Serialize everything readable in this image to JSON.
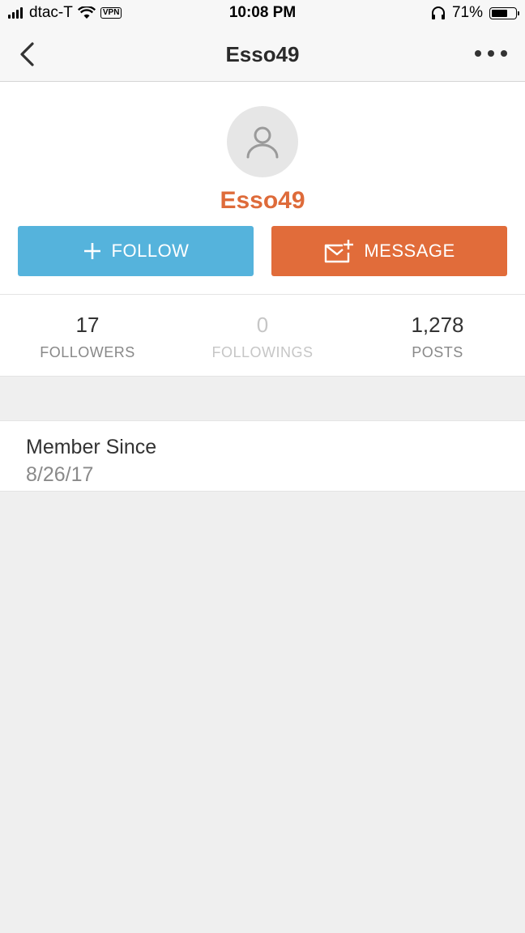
{
  "status_bar": {
    "carrier": "dtac-T",
    "vpn_label": "VPN",
    "time": "10:08 PM",
    "battery_percent": "71%",
    "battery_level": 0.71,
    "icons": [
      "signal-icon",
      "wifi-icon",
      "vpn-icon",
      "headphones-icon",
      "battery-icon"
    ]
  },
  "nav": {
    "title": "Esso49",
    "back_icon": "chevron-left-icon",
    "more_icon": "more-dots-icon"
  },
  "profile": {
    "avatar_icon": "user-icon",
    "username": "Esso49",
    "follow_label": "FOLLOW",
    "message_label": "MESSAGE",
    "colors": {
      "follow": "#55b3dc",
      "message": "#e16c3a",
      "username": "#de6b3a"
    }
  },
  "stats": [
    {
      "value": "17",
      "label": "FOLLOWERS"
    },
    {
      "value": "0",
      "label": "FOLLOWINGS"
    },
    {
      "value": "1,278",
      "label": "POSTS"
    }
  ],
  "member": {
    "label": "Member Since",
    "date": "8/26/17"
  }
}
